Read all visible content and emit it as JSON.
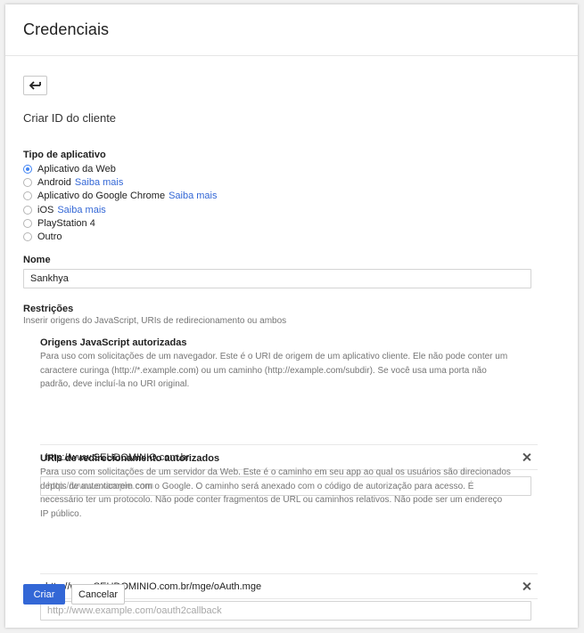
{
  "header": {
    "title": "Credenciais"
  },
  "form": {
    "back_icon": "back-arrow-icon",
    "subtitle": "Criar ID do cliente",
    "app_type": {
      "label": "Tipo de aplicativo",
      "selected": "Aplicativo da Web",
      "options": [
        {
          "label": "Aplicativo da Web",
          "link": ""
        },
        {
          "label": "Android",
          "link": "Saiba mais"
        },
        {
          "label": "Aplicativo do Google Chrome",
          "link": "Saiba mais"
        },
        {
          "label": "iOS",
          "link": "Saiba mais"
        },
        {
          "label": "PlayStation 4",
          "link": ""
        },
        {
          "label": "Outro",
          "link": ""
        }
      ]
    },
    "name": {
      "label": "Nome",
      "value": "Sankhya"
    },
    "restrictions": {
      "label": "Restrições",
      "hint": "Inserir origens do JavaScript, URIs de redirecionamento ou ambos",
      "js_origins": {
        "title": "Origens JavaScript autorizadas",
        "desc_lines": [
          "Para uso com solicitações de um navegador. Este é o URI de origem de um aplicativo cliente. Ele não pode conter um",
          "caractere curinga (http://*.example.com) ou um caminho (http://example.com/subdir). Se você usa uma porta não",
          "padrão, deve incluí-la no URI original."
        ],
        "entry": "http://www.SEUDOMINIO.com.br",
        "placeholder": "http://www.example.com"
      },
      "redirect_uris": {
        "title": "URIs de redirecionamento autorizados",
        "desc_lines": [
          "Para uso com solicitações de um servidor da Web. Este é o caminho em seu app ao qual os usuários são direcionados",
          "depois de autenticarem com o Google. O caminho será anexado com o código de autorização para acesso. É",
          "necessário ter um protocolo. Não pode conter fragmentos de URL ou caminhos relativos. Não pode ser um endereço",
          "IP público."
        ],
        "entry": "http://www.SEUDOMINIO.com.br/mge/oAuth.mge",
        "placeholder": "http://www.example.com/oauth2callback"
      }
    },
    "buttons": {
      "create": "Criar",
      "cancel": "Cancelar"
    }
  },
  "colors": {
    "accent": "#3367d6",
    "radio": "#4285f4"
  }
}
